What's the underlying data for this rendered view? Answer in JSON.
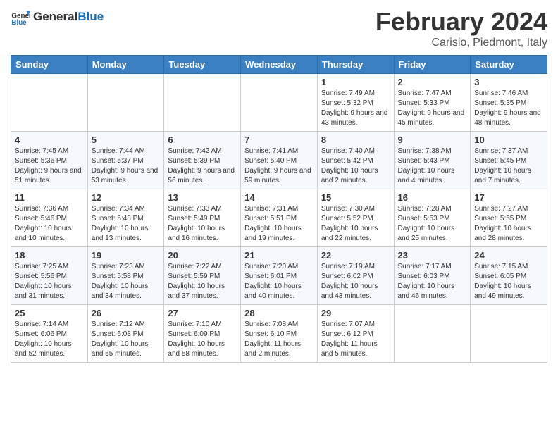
{
  "header": {
    "logo_general": "General",
    "logo_blue": "Blue",
    "month_title": "February 2024",
    "location": "Carisio, Piedmont, Italy"
  },
  "days_of_week": [
    "Sunday",
    "Monday",
    "Tuesday",
    "Wednesday",
    "Thursday",
    "Friday",
    "Saturday"
  ],
  "weeks": [
    [
      {
        "day": "",
        "sunrise": "",
        "sunset": "",
        "daylight": ""
      },
      {
        "day": "",
        "sunrise": "",
        "sunset": "",
        "daylight": ""
      },
      {
        "day": "",
        "sunrise": "",
        "sunset": "",
        "daylight": ""
      },
      {
        "day": "",
        "sunrise": "",
        "sunset": "",
        "daylight": ""
      },
      {
        "day": "1",
        "sunrise": "7:49 AM",
        "sunset": "5:32 PM",
        "daylight": "9 hours and 43 minutes."
      },
      {
        "day": "2",
        "sunrise": "7:47 AM",
        "sunset": "5:33 PM",
        "daylight": "9 hours and 45 minutes."
      },
      {
        "day": "3",
        "sunrise": "7:46 AM",
        "sunset": "5:35 PM",
        "daylight": "9 hours and 48 minutes."
      }
    ],
    [
      {
        "day": "4",
        "sunrise": "7:45 AM",
        "sunset": "5:36 PM",
        "daylight": "9 hours and 51 minutes."
      },
      {
        "day": "5",
        "sunrise": "7:44 AM",
        "sunset": "5:37 PM",
        "daylight": "9 hours and 53 minutes."
      },
      {
        "day": "6",
        "sunrise": "7:42 AM",
        "sunset": "5:39 PM",
        "daylight": "9 hours and 56 minutes."
      },
      {
        "day": "7",
        "sunrise": "7:41 AM",
        "sunset": "5:40 PM",
        "daylight": "9 hours and 59 minutes."
      },
      {
        "day": "8",
        "sunrise": "7:40 AM",
        "sunset": "5:42 PM",
        "daylight": "10 hours and 2 minutes."
      },
      {
        "day": "9",
        "sunrise": "7:38 AM",
        "sunset": "5:43 PM",
        "daylight": "10 hours and 4 minutes."
      },
      {
        "day": "10",
        "sunrise": "7:37 AM",
        "sunset": "5:45 PM",
        "daylight": "10 hours and 7 minutes."
      }
    ],
    [
      {
        "day": "11",
        "sunrise": "7:36 AM",
        "sunset": "5:46 PM",
        "daylight": "10 hours and 10 minutes."
      },
      {
        "day": "12",
        "sunrise": "7:34 AM",
        "sunset": "5:48 PM",
        "daylight": "10 hours and 13 minutes."
      },
      {
        "day": "13",
        "sunrise": "7:33 AM",
        "sunset": "5:49 PM",
        "daylight": "10 hours and 16 minutes."
      },
      {
        "day": "14",
        "sunrise": "7:31 AM",
        "sunset": "5:51 PM",
        "daylight": "10 hours and 19 minutes."
      },
      {
        "day": "15",
        "sunrise": "7:30 AM",
        "sunset": "5:52 PM",
        "daylight": "10 hours and 22 minutes."
      },
      {
        "day": "16",
        "sunrise": "7:28 AM",
        "sunset": "5:53 PM",
        "daylight": "10 hours and 25 minutes."
      },
      {
        "day": "17",
        "sunrise": "7:27 AM",
        "sunset": "5:55 PM",
        "daylight": "10 hours and 28 minutes."
      }
    ],
    [
      {
        "day": "18",
        "sunrise": "7:25 AM",
        "sunset": "5:56 PM",
        "daylight": "10 hours and 31 minutes."
      },
      {
        "day": "19",
        "sunrise": "7:23 AM",
        "sunset": "5:58 PM",
        "daylight": "10 hours and 34 minutes."
      },
      {
        "day": "20",
        "sunrise": "7:22 AM",
        "sunset": "5:59 PM",
        "daylight": "10 hours and 37 minutes."
      },
      {
        "day": "21",
        "sunrise": "7:20 AM",
        "sunset": "6:01 PM",
        "daylight": "10 hours and 40 minutes."
      },
      {
        "day": "22",
        "sunrise": "7:19 AM",
        "sunset": "6:02 PM",
        "daylight": "10 hours and 43 minutes."
      },
      {
        "day": "23",
        "sunrise": "7:17 AM",
        "sunset": "6:03 PM",
        "daylight": "10 hours and 46 minutes."
      },
      {
        "day": "24",
        "sunrise": "7:15 AM",
        "sunset": "6:05 PM",
        "daylight": "10 hours and 49 minutes."
      }
    ],
    [
      {
        "day": "25",
        "sunrise": "7:14 AM",
        "sunset": "6:06 PM",
        "daylight": "10 hours and 52 minutes."
      },
      {
        "day": "26",
        "sunrise": "7:12 AM",
        "sunset": "6:08 PM",
        "daylight": "10 hours and 55 minutes."
      },
      {
        "day": "27",
        "sunrise": "7:10 AM",
        "sunset": "6:09 PM",
        "daylight": "10 hours and 58 minutes."
      },
      {
        "day": "28",
        "sunrise": "7:08 AM",
        "sunset": "6:10 PM",
        "daylight": "11 hours and 2 minutes."
      },
      {
        "day": "29",
        "sunrise": "7:07 AM",
        "sunset": "6:12 PM",
        "daylight": "11 hours and 5 minutes."
      },
      {
        "day": "",
        "sunrise": "",
        "sunset": "",
        "daylight": ""
      },
      {
        "day": "",
        "sunrise": "",
        "sunset": "",
        "daylight": ""
      }
    ]
  ],
  "labels": {
    "sunrise_prefix": "Sunrise: ",
    "sunset_prefix": "Sunset: ",
    "daylight_prefix": "Daylight: "
  }
}
